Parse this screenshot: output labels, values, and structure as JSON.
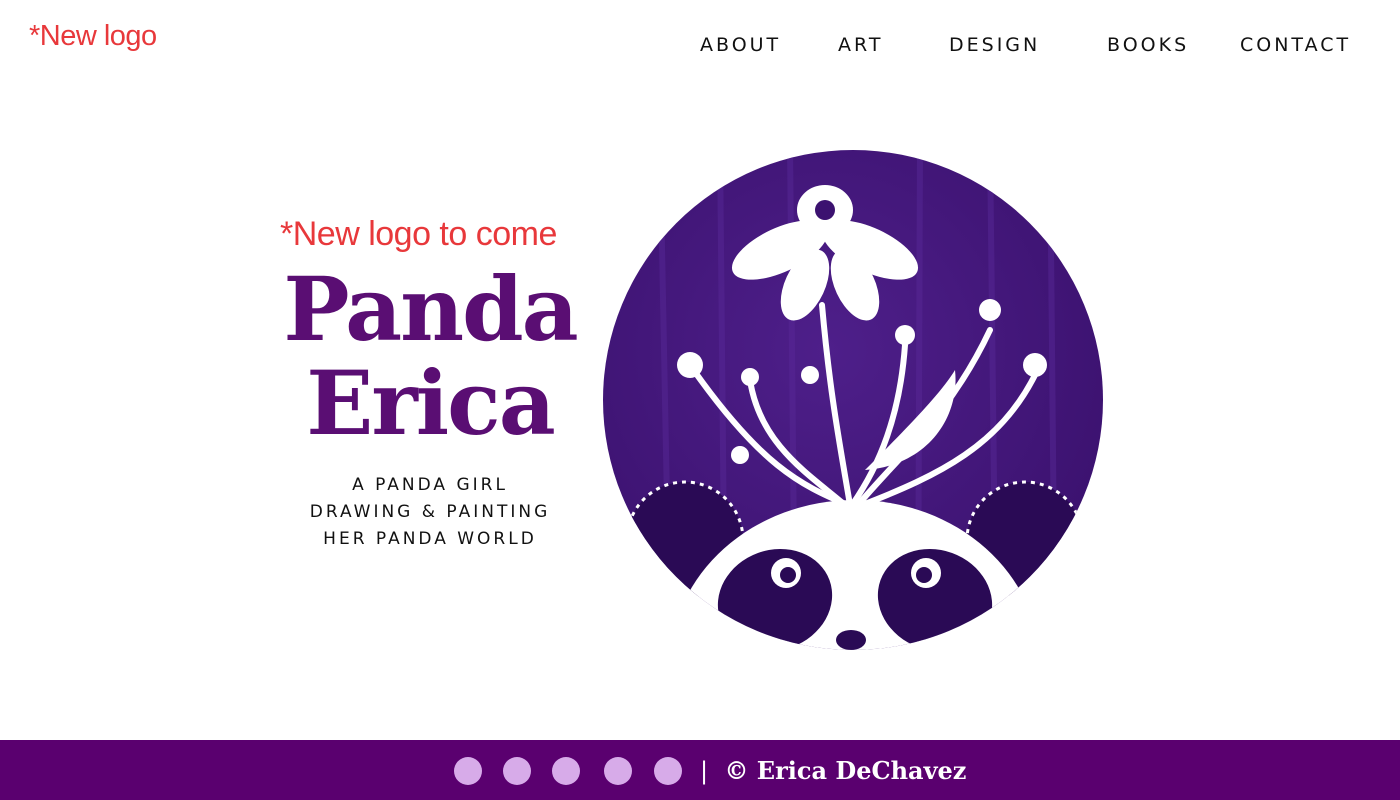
{
  "header": {
    "logo_note": "*New logo",
    "nav": [
      {
        "label": "ABOUT"
      },
      {
        "label": "ART"
      },
      {
        "label": "DESIGN"
      },
      {
        "label": "BOOKS"
      },
      {
        "label": "CONTACT"
      }
    ]
  },
  "hero": {
    "note": "*New logo to come",
    "title_line1": "Panda",
    "title_line2": "Erica",
    "tagline": [
      "A PANDA GIRL",
      "DRAWING & PAINTING",
      "HER PANDA WORLD"
    ],
    "image_icon": "panda-flower-illustration"
  },
  "footer": {
    "social_icons": [
      "social-icon",
      "social-icon",
      "social-icon",
      "social-icon",
      "social-icon"
    ],
    "separator": "|",
    "copyright": "© Erica DeChavez"
  },
  "colors": {
    "brand_purple": "#5a0e73",
    "footer_bg": "#5a006f",
    "note_red": "#e8383b",
    "dot_lavender": "#d7abe9"
  }
}
